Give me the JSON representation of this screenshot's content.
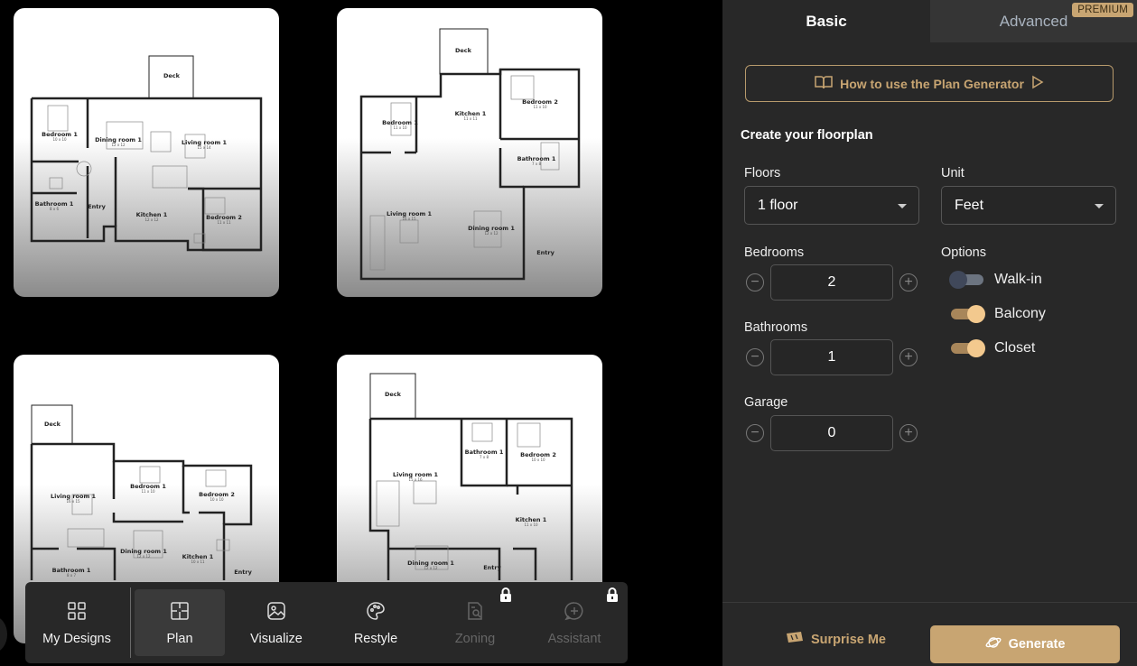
{
  "plans": [
    {
      "deck": "Deck",
      "rooms": [
        {
          "name": "Bedroom 1",
          "dims": "10 x 10"
        },
        {
          "name": "Dining room 1",
          "dims": "12 x 12"
        },
        {
          "name": "Living room 1",
          "dims": "15 x 14"
        },
        {
          "name": "Bathroom 1",
          "dims": "8 x 6"
        },
        {
          "name": "Entry",
          "dims": ""
        },
        {
          "name": "Kitchen 1",
          "dims": "12 x 12"
        },
        {
          "name": "Bedroom 2",
          "dims": "11 x 11"
        }
      ]
    },
    {
      "deck": "Deck",
      "rooms": [
        {
          "name": "Bedroom 1",
          "dims": "11 x 10"
        },
        {
          "name": "Kitchen 1",
          "dims": "11 x 11"
        },
        {
          "name": "Bedroom 2",
          "dims": "11 x 10"
        },
        {
          "name": "Bathroom 1",
          "dims": "7 x 8"
        },
        {
          "name": "Living room 1",
          "dims": "16 x 15"
        },
        {
          "name": "Dining room 1",
          "dims": "12 x 12"
        },
        {
          "name": "Entry",
          "dims": ""
        }
      ]
    },
    {
      "deck": "Deck",
      "rooms": [
        {
          "name": "Living room 1",
          "dims": "16 x 15"
        },
        {
          "name": "Bedroom 1",
          "dims": "11 x 10"
        },
        {
          "name": "Bedroom 2",
          "dims": "10 x 10"
        },
        {
          "name": "Dining room 1",
          "dims": "12 x 12"
        },
        {
          "name": "Kitchen 1",
          "dims": "10 x 11"
        },
        {
          "name": "Bathroom 1",
          "dims": "8 x 7"
        },
        {
          "name": "Entry",
          "dims": ""
        }
      ]
    },
    {
      "deck": "Deck",
      "rooms": [
        {
          "name": "Bathroom 1",
          "dims": "7 x 8"
        },
        {
          "name": "Bedroom 2",
          "dims": "10 x 10"
        },
        {
          "name": "Living room 1",
          "dims": "15 x 16"
        },
        {
          "name": "Kitchen 1",
          "dims": "11 x 10"
        },
        {
          "name": "Dining room 1",
          "dims": "12 x 12"
        },
        {
          "name": "Entry",
          "dims": ""
        }
      ]
    }
  ],
  "toolbar": {
    "items": [
      {
        "label": "My Designs",
        "icon": "grid-icon",
        "state": "normal"
      },
      {
        "label": "Plan",
        "icon": "floorplan-icon",
        "state": "active"
      },
      {
        "label": "Visualize",
        "icon": "image-icon",
        "state": "normal"
      },
      {
        "label": "Restyle",
        "icon": "palette-icon",
        "state": "normal"
      },
      {
        "label": "Zoning",
        "icon": "document-search-icon",
        "state": "locked"
      },
      {
        "label": "Assistant",
        "icon": "chat-plus-icon",
        "state": "locked"
      }
    ]
  },
  "panel": {
    "tabs": {
      "basic": "Basic",
      "advanced": "Advanced",
      "premium_badge": "PREMIUM"
    },
    "howto": "How to use the Plan Generator",
    "heading": "Create your floorplan",
    "floors": {
      "label": "Floors",
      "value": "1 floor"
    },
    "unit": {
      "label": "Unit",
      "value": "Feet"
    },
    "bedrooms": {
      "label": "Bedrooms",
      "value": "2"
    },
    "bathrooms": {
      "label": "Bathrooms",
      "value": "1"
    },
    "garage": {
      "label": "Garage",
      "value": "0"
    },
    "options": {
      "label": "Options",
      "items": [
        {
          "label": "Walk-in",
          "enabled": false
        },
        {
          "label": "Balcony",
          "enabled": true
        },
        {
          "label": "Closet",
          "enabled": true
        }
      ]
    },
    "surprise": "Surprise Me",
    "generate": "Generate"
  },
  "colors": {
    "accent": "#c8a572",
    "panel_bg": "#282828",
    "toolbar_bg": "#282828"
  }
}
